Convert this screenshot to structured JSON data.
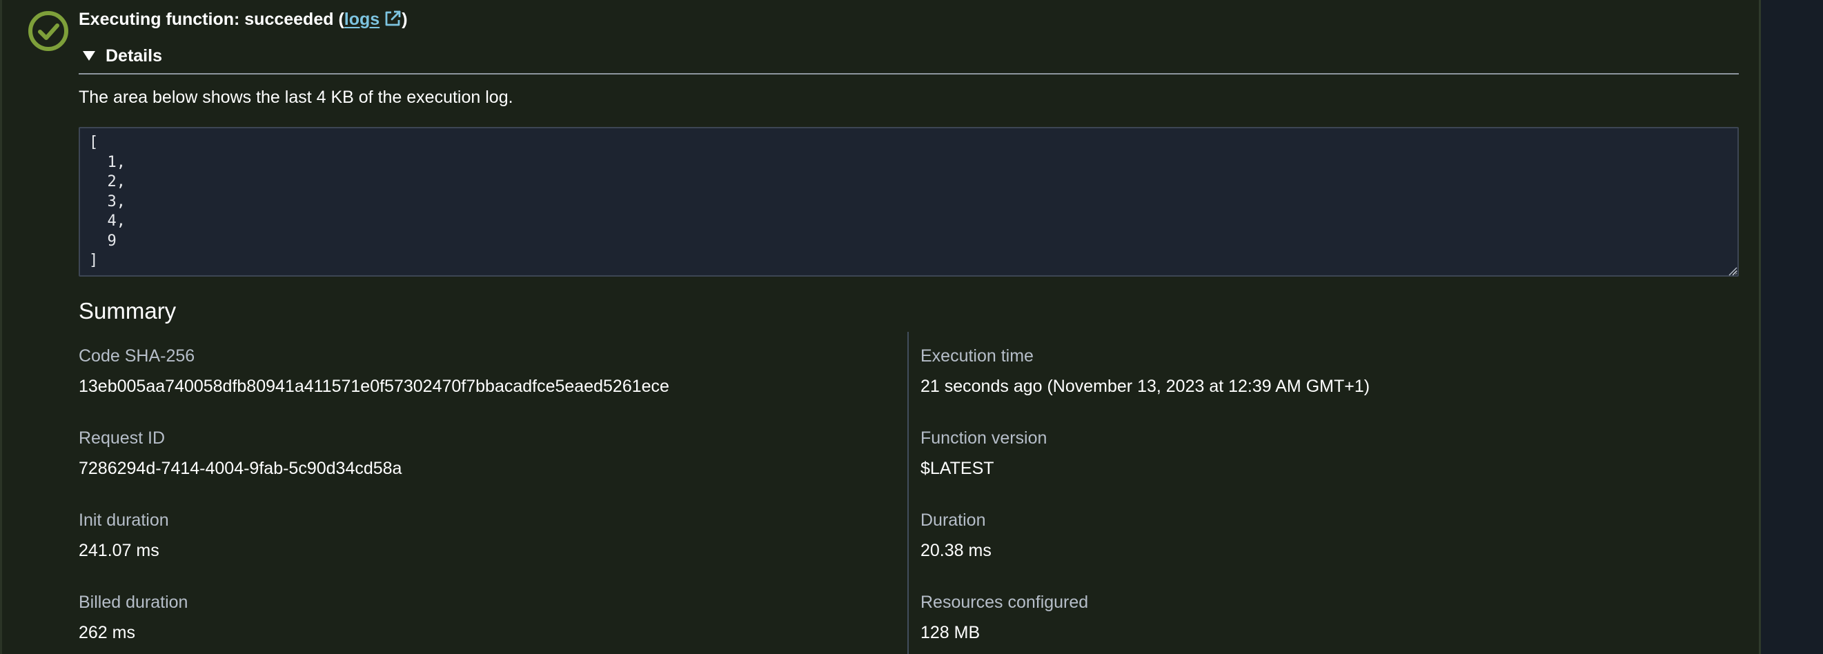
{
  "status": {
    "prefix": "Executing function: succeeded (",
    "link_label": "logs",
    "suffix": ")",
    "icon": "success-check-circle-icon",
    "accent_color": "#7ea03a"
  },
  "details": {
    "toggle_label": "Details",
    "expanded": true,
    "note": "The area below shows the last 4 KB of the execution log.",
    "log_output": "[\n  1,\n  2,\n  3,\n  4,\n  9\n]"
  },
  "summary": {
    "title": "Summary",
    "left_column": [
      {
        "label": "Code SHA-256",
        "value": "13eb005aa740058dfb80941a411571e0f57302470f7bbacadfce5eaed5261ece"
      },
      {
        "label": "Request ID",
        "value": "7286294d-7414-4004-9fab-5c90d34cd58a"
      },
      {
        "label": "Init duration",
        "value": "241.07 ms"
      },
      {
        "label": "Billed duration",
        "value": "262 ms"
      }
    ],
    "right_column": [
      {
        "label": "Execution time",
        "value": "21 seconds ago (November 13, 2023 at 12:39 AM GMT+1)"
      },
      {
        "label": "Function version",
        "value": "$LATEST"
      },
      {
        "label": "Duration",
        "value": "20.38 ms"
      },
      {
        "label": "Resources configured",
        "value": "128 MB"
      }
    ]
  }
}
